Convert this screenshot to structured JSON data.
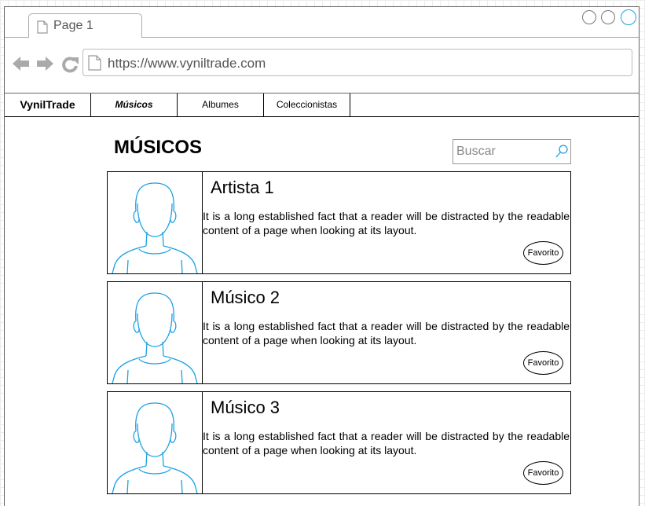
{
  "browser": {
    "tab_title": "Page 1",
    "url": "https://www.vyniltrade.com"
  },
  "menu": {
    "brand": "VynilTrade",
    "items": [
      {
        "label": "Músicos",
        "active": true
      },
      {
        "label": "Albumes",
        "active": false
      },
      {
        "label": "Coleccionistas",
        "active": false
      }
    ]
  },
  "page": {
    "title": "MÚSICOS",
    "search_placeholder": "Buscar"
  },
  "cards": [
    {
      "name": "Artista 1",
      "description": "It is a long established fact that a reader will be distracted by the readable content of a page when looking at its layout.",
      "button": "Favorito"
    },
    {
      "name": "Músico 2",
      "description": "It is a long established fact that a reader will be distracted by the readable content of a page when looking at its layout.",
      "button": "Favorito"
    },
    {
      "name": "Músico 3",
      "description": "It is a long established fact that a reader will be distracted by the readable content of a page when looking at its layout.",
      "button": "Favorito"
    }
  ],
  "colors": {
    "accent": "#1ba1e2",
    "border": "#000000"
  }
}
